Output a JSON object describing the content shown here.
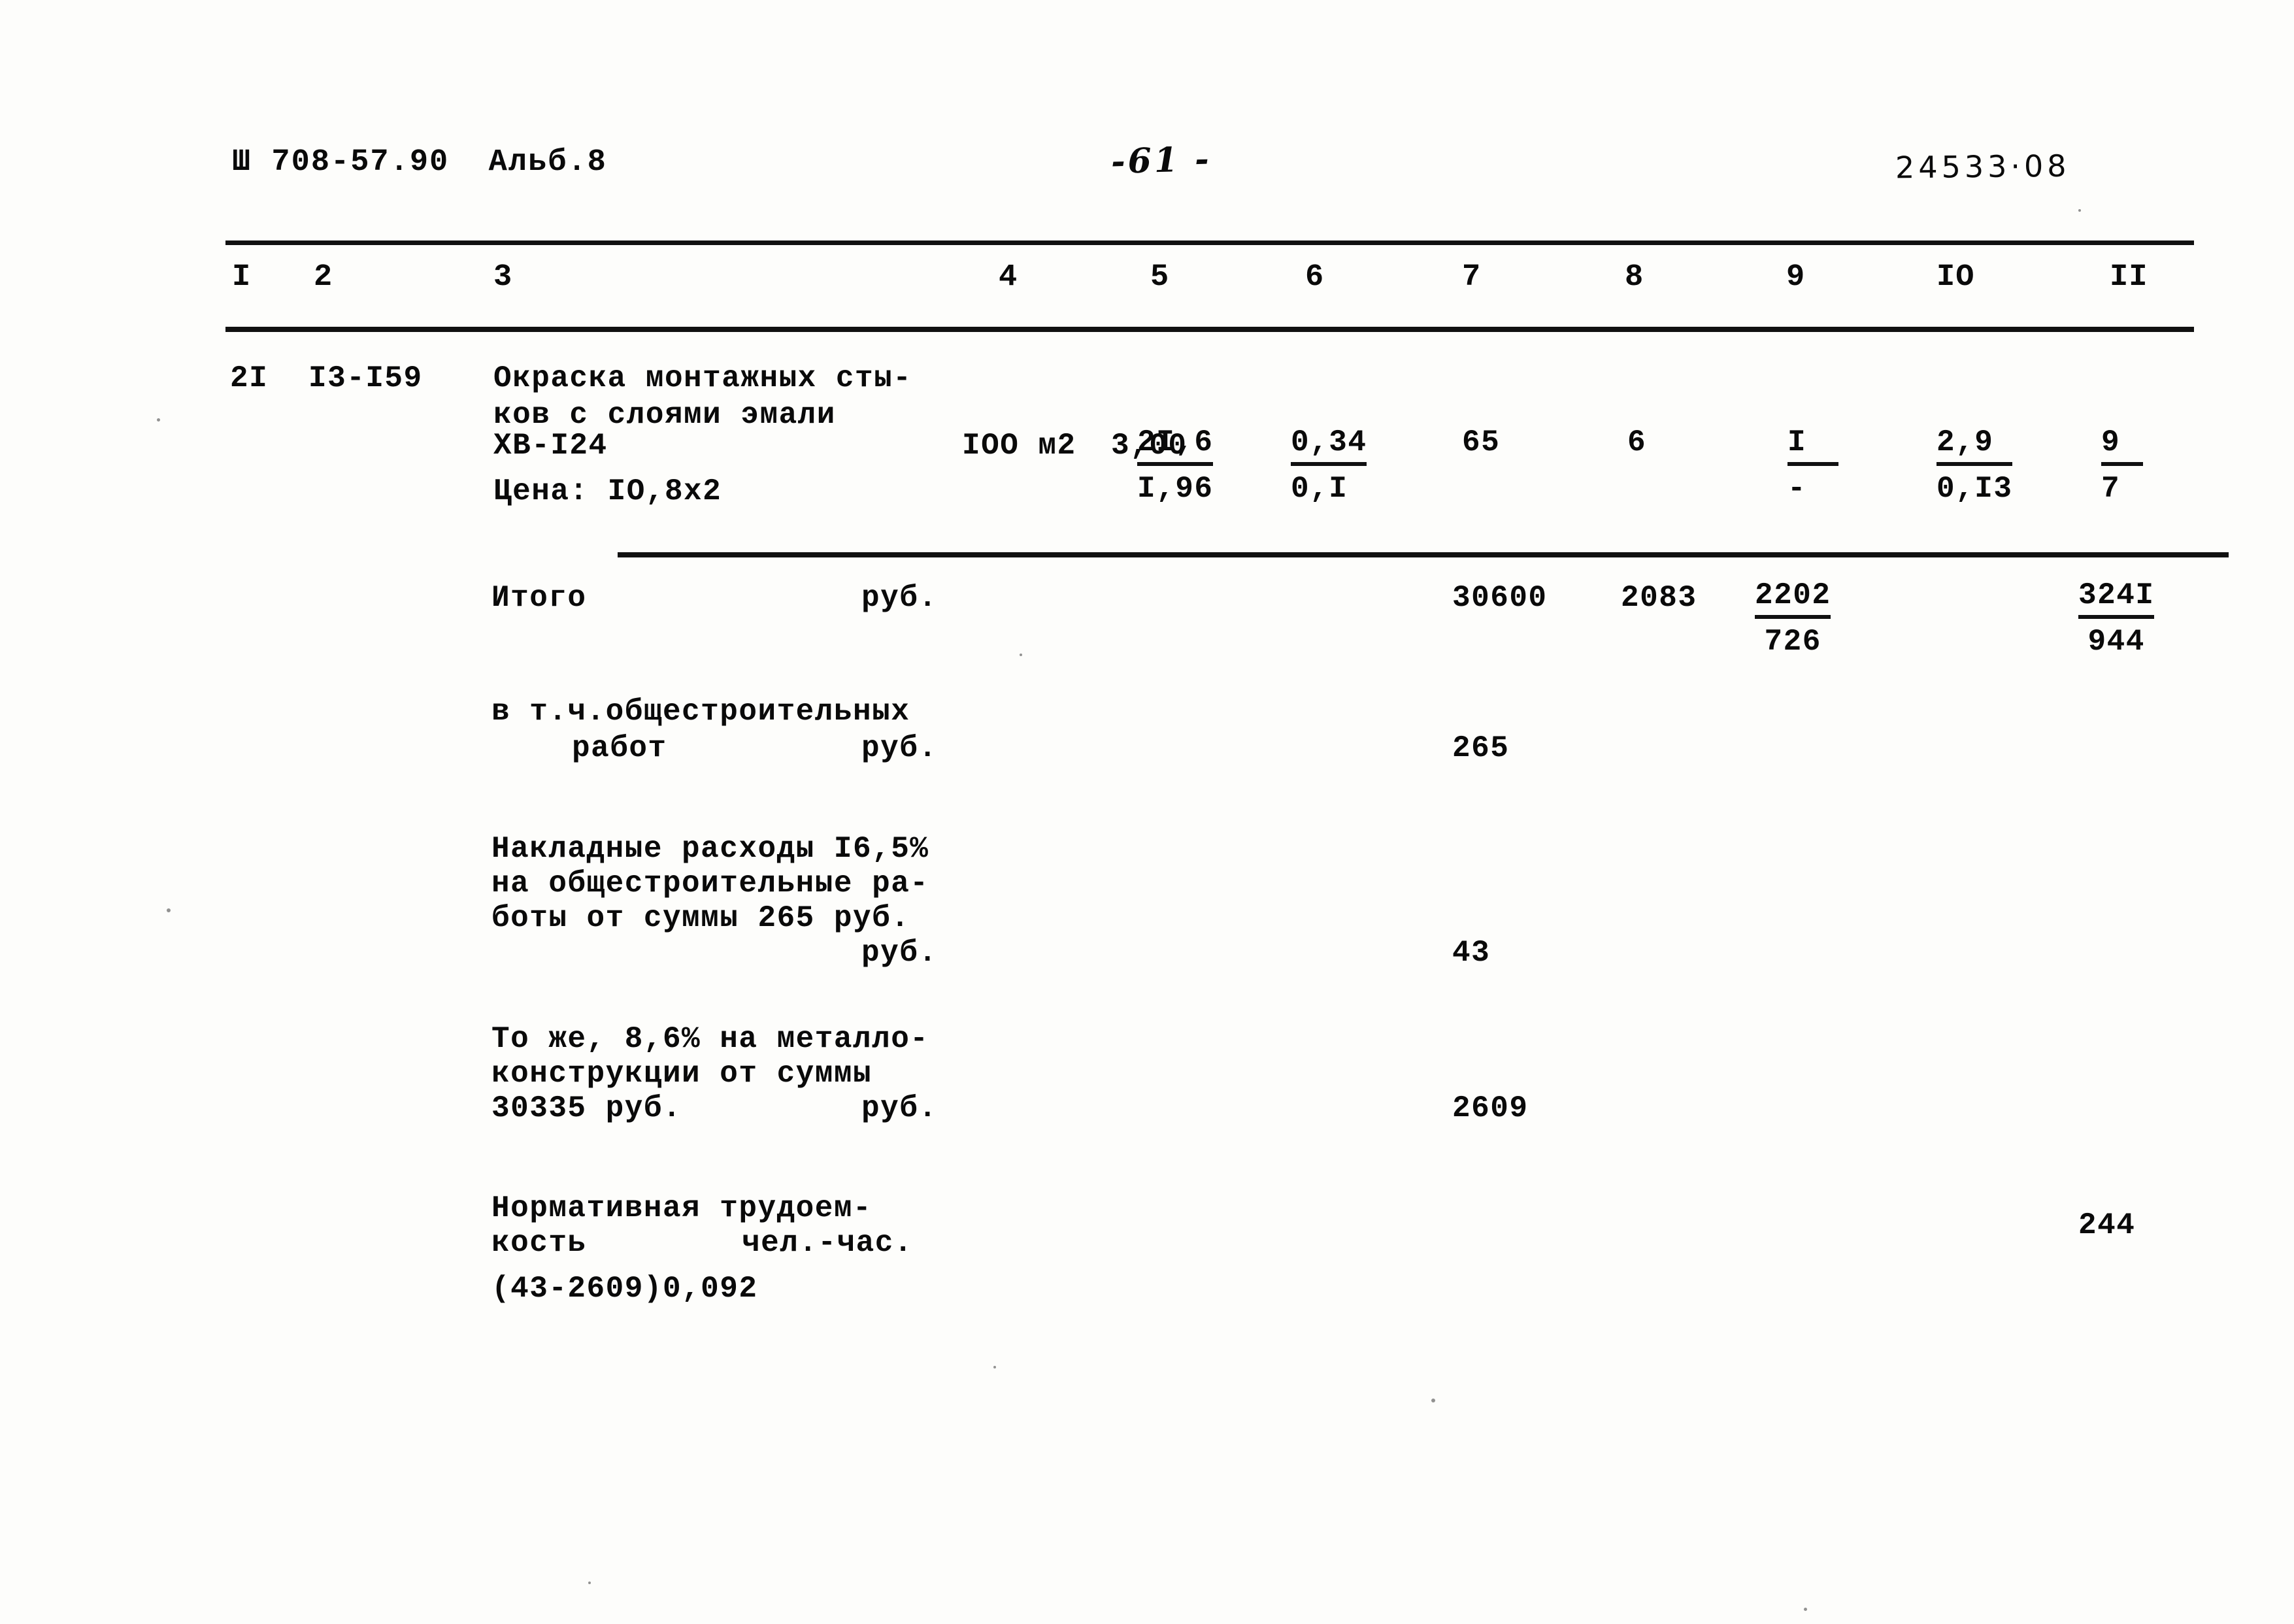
{
  "header": {
    "doc_code": "Ш 708-57.90  Альб.8",
    "page_number": "-61 -",
    "sheet_code": "24533·08"
  },
  "table": {
    "column_headers": [
      "I",
      "2",
      "3",
      "4",
      "5",
      "6",
      "7",
      "8",
      "9",
      "IO",
      "II"
    ],
    "main_row": {
      "col1_position": "2I",
      "col2_code": "I3-I59",
      "col3_description_line1": "Окраска монтажных сты-",
      "col3_description_line2": "ков с слоями эмали",
      "col3_description_line3": "ХВ-I24",
      "col3_price_line": "Цена: IO,8x2",
      "col4_unit": "IOO м2",
      "col5_qty": "3,00",
      "col6_num": "2I,6",
      "col6_den": "I,96",
      "col7_num": "0,34",
      "col7_den": "0,I",
      "col8_value": "65",
      "col9_value": "6",
      "col10_num": "I",
      "col10_den": "-",
      "col11_num": "2,9",
      "col11_den": "0,I3",
      "col12_num": "9",
      "col12_den": "7"
    },
    "total_row": {
      "label": "Итого",
      "unit": "руб.",
      "col7": "30600",
      "col8": "2083",
      "col9_num": "2202",
      "col9_den": "726",
      "col11_num": "324I",
      "col11_den": "944"
    },
    "general_construction_row": {
      "label_line1": "в т.ч.общестроительных",
      "label_line2": "работ",
      "unit": "руб.",
      "value": "265"
    },
    "overhead_row": {
      "label_line1": "Накладные расходы I6,5%",
      "label_line2": "на общестроительные ра-",
      "label_line3": "боты от суммы 265 руб.",
      "unit": "руб.",
      "value": "43"
    },
    "metalwork_row": {
      "label_line1": "То же, 8,6% на металло-",
      "label_line2": "конструкции от суммы",
      "label_line3": "30335 руб.",
      "unit": "руб.",
      "value": "2609"
    },
    "labor_row": {
      "label_line1": "Нормативная трудоем-",
      "label_line2": "кость",
      "unit": "чел.-час.",
      "formula": "(43-2609)0,092",
      "value": "244"
    }
  }
}
